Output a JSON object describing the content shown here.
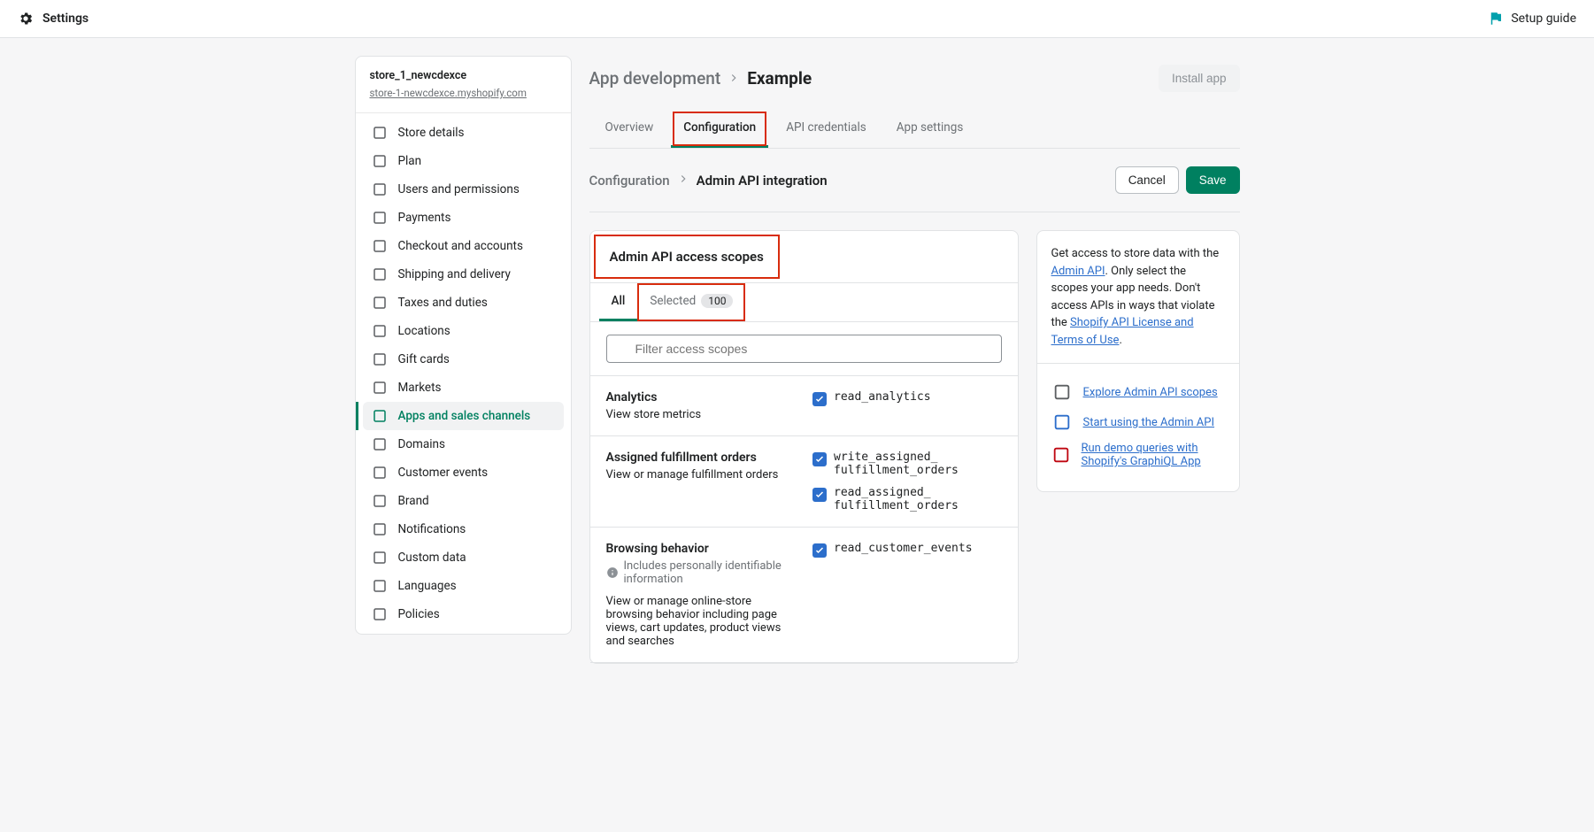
{
  "topbar": {
    "title": "Settings",
    "setup_guide": "Setup guide"
  },
  "sidebar": {
    "store_name": "store_1_newcdexce",
    "store_url": "store-1-newcdexce.myshopify.com",
    "items": [
      "Store details",
      "Plan",
      "Users and permissions",
      "Payments",
      "Checkout and accounts",
      "Shipping and delivery",
      "Taxes and duties",
      "Locations",
      "Gift cards",
      "Markets",
      "Apps and sales channels",
      "Domains",
      "Customer events",
      "Brand",
      "Notifications",
      "Custom data",
      "Languages",
      "Policies"
    ],
    "active_index": 10
  },
  "page": {
    "crumb1": "App development",
    "crumb2": "Example",
    "install_btn": "Install app"
  },
  "tabs": [
    "Overview",
    "Configuration",
    "API credentials",
    "App settings"
  ],
  "subheader": {
    "crumb1": "Configuration",
    "crumb2": "Admin API integration",
    "cancel": "Cancel",
    "save": "Save"
  },
  "scopes_card": {
    "title": "Admin API access scopes",
    "tab_all": "All",
    "tab_selected": "Selected",
    "tab_selected_count": "100",
    "search_placeholder": "Filter access scopes"
  },
  "scopes": [
    {
      "title": "Analytics",
      "desc": "View store metrics",
      "note": null,
      "checks": [
        {
          "label": "read_analytics"
        }
      ]
    },
    {
      "title": "Assigned fulfillment orders",
      "desc": "View or manage fulfillment orders",
      "note": null,
      "checks": [
        {
          "label": "write_assigned_ fulfillment_orders"
        },
        {
          "label": "read_assigned_ fulfillment_orders"
        }
      ]
    },
    {
      "title": "Browsing behavior",
      "desc": "View or manage online-store browsing behavior including page views, cart updates, product views and searches",
      "note": "Includes personally identifiable information",
      "checks": [
        {
          "label": "read_customer_events"
        }
      ]
    }
  ],
  "side": {
    "text_pre": "Get access to store data with the ",
    "text_link1": "Admin API",
    "text_mid": ". Only select the scopes your app needs. Don't access APIs in ways that violate the ",
    "text_link2": "Shopify API License and Terms of Use",
    "text_post": ".",
    "links": [
      "Explore Admin API scopes",
      "Start using the Admin API",
      "Run demo queries with Shopify's GraphiQL App"
    ]
  }
}
